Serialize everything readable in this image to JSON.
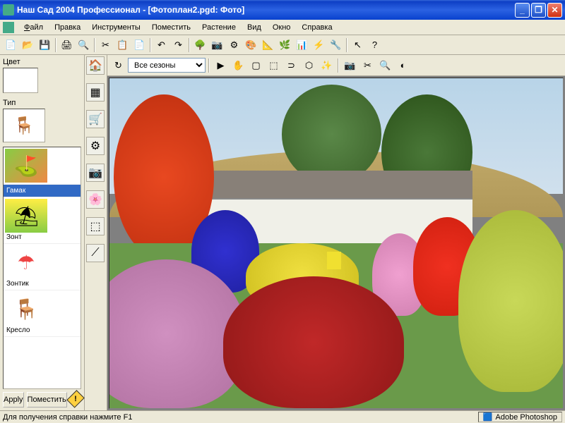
{
  "window": {
    "title": "Наш Сад 2004 Профессионал - [Фотоплан2.pgd: Фото]"
  },
  "menu": {
    "file": "Файл",
    "edit": "Правка",
    "tools": "Инструменты",
    "place": "Поместить",
    "plant": "Растение",
    "view": "Вид",
    "window": "Окно",
    "help": "Справка"
  },
  "toolbar": {
    "season_label": "Все сезоны"
  },
  "left_panel": {
    "color_label": "Цвет",
    "type_label": "Тип",
    "items": [
      {
        "label": "Гамак",
        "selected": true
      },
      {
        "label": "Зонт",
        "selected": false
      },
      {
        "label": "Зонтик",
        "selected": false
      },
      {
        "label": "Кресло",
        "selected": false
      }
    ],
    "apply_btn": "Apply",
    "place_btn": "Поместить"
  },
  "statusbar": {
    "help_text": "Для получения справки нажмите F1",
    "app_indicator": "Adobe Photoshop"
  }
}
